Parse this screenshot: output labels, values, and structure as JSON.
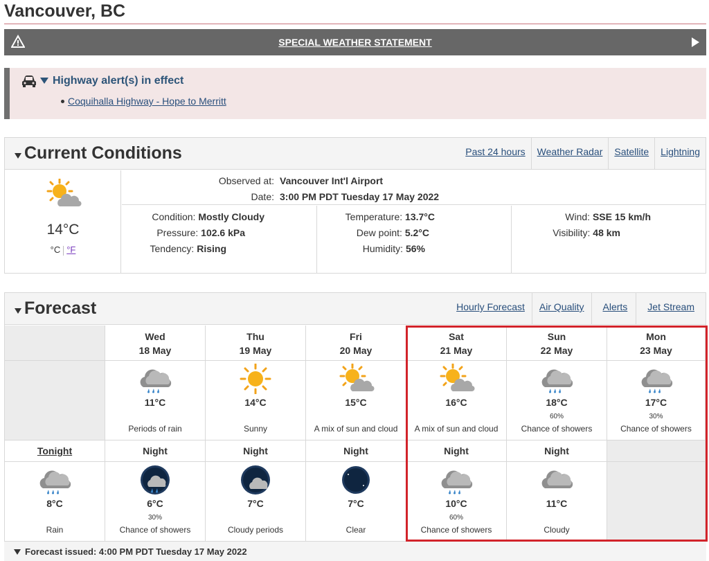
{
  "location": "Vancouver, BC",
  "special_statement": "SPECIAL WEATHER STATEMENT",
  "highway": {
    "heading": "Highway alert(s) in effect",
    "item": "Coquihalla Highway - Hope to Merritt"
  },
  "current": {
    "title": "Current Conditions",
    "links": [
      "Past 24 hours",
      "Weather Radar",
      "Satellite",
      "Lightning"
    ],
    "temp": "14°C",
    "unit_c": "°C",
    "unit_f": "°F",
    "observed_label": "Observed at:",
    "observed_value": "Vancouver Int'l Airport",
    "date_label": "Date:",
    "date_value": "3:00 PM PDT Tuesday 17 May 2022",
    "condition_label": "Condition:",
    "condition_value": "Mostly Cloudy",
    "pressure_label": "Pressure:",
    "pressure_value": "102.6 kPa",
    "tendency_label": "Tendency:",
    "tendency_value": "Rising",
    "temperature_label": "Temperature:",
    "temperature_value": "13.7°C",
    "dewpoint_label": "Dew point:",
    "dewpoint_value": "5.2°C",
    "humidity_label": "Humidity:",
    "humidity_value": "56%",
    "wind_label": "Wind:",
    "wind_value": "SSE 15 km/h",
    "visibility_label": "Visibility:",
    "visibility_value": "48 km"
  },
  "forecast": {
    "title": "Forecast",
    "links": [
      "Hourly Forecast",
      "Air Quality",
      "Alerts",
      "Jet Stream"
    ],
    "days": [
      {
        "day": "Wed",
        "date": "18 May",
        "temp": "11°C",
        "pop": "",
        "summary": "Periods of rain",
        "icon": "rain-cloud-icon"
      },
      {
        "day": "Thu",
        "date": "19 May",
        "temp": "14°C",
        "pop": "",
        "summary": "Sunny",
        "icon": "sun-icon"
      },
      {
        "day": "Fri",
        "date": "20 May",
        "temp": "15°C",
        "pop": "",
        "summary": "A mix of sun and cloud",
        "icon": "sun-cloud-icon"
      },
      {
        "day": "Sat",
        "date": "21 May",
        "temp": "16°C",
        "pop": "",
        "summary": "A mix of sun and cloud",
        "icon": "sun-cloud-icon"
      },
      {
        "day": "Sun",
        "date": "22 May",
        "temp": "18°C",
        "pop": "60%",
        "summary": "Chance of showers",
        "icon": "shower-cloud-icon"
      },
      {
        "day": "Mon",
        "date": "23 May",
        "temp": "17°C",
        "pop": "30%",
        "summary": "Chance of showers",
        "icon": "shower-cloud-icon"
      }
    ],
    "tonight_label": "Tonight",
    "tonight": {
      "temp": "8°C",
      "pop": "",
      "summary": "Rain",
      "icon": "rain-cloud-icon"
    },
    "nights": [
      {
        "label": "Night",
        "temp": "6°C",
        "pop": "30%",
        "summary": "Chance of showers",
        "icon": "night-shower-icon"
      },
      {
        "label": "Night",
        "temp": "7°C",
        "pop": "",
        "summary": "Cloudy periods",
        "icon": "night-cloudy-icon"
      },
      {
        "label": "Night",
        "temp": "7°C",
        "pop": "",
        "summary": "Clear",
        "icon": "moon-icon"
      },
      {
        "label": "Night",
        "temp": "10°C",
        "pop": "60%",
        "summary": "Chance of showers",
        "icon": "shower-cloud-icon"
      },
      {
        "label": "Night",
        "temp": "11°C",
        "pop": "",
        "summary": "Cloudy",
        "icon": "cloud-icon"
      }
    ],
    "issued": "Forecast issued: 4:00 PM PDT Tuesday 17 May 2022"
  },
  "colors": {
    "highlight": "#d2232a",
    "link": "#284e7b",
    "banner": "#676767"
  }
}
